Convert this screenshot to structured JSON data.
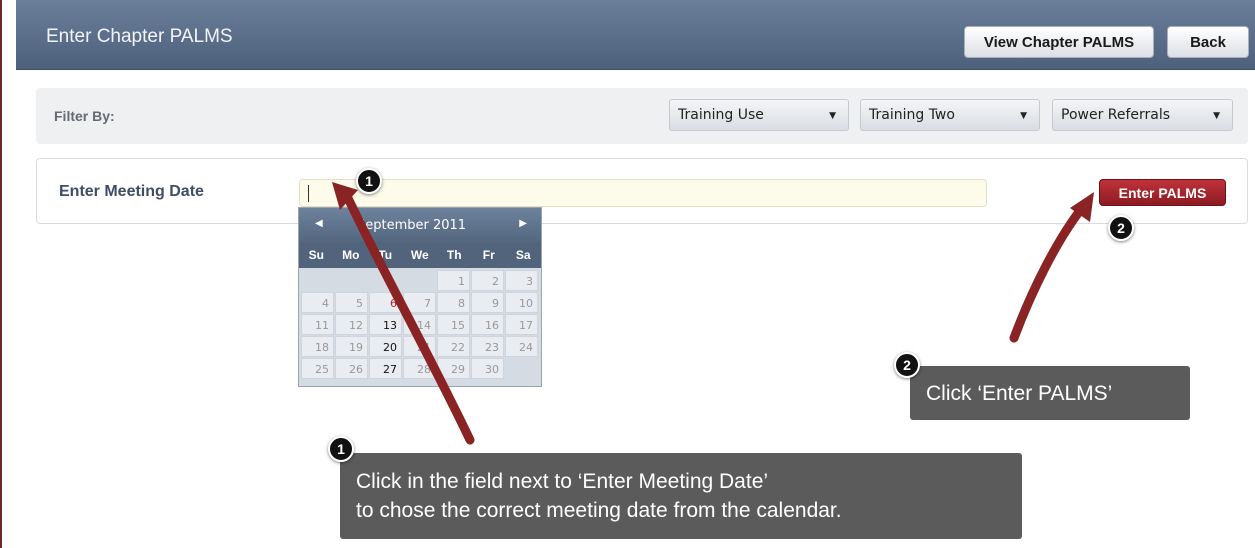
{
  "header": {
    "title": "Enter Chapter PALMS",
    "view_button": "View Chapter PALMS",
    "back_button": "Back"
  },
  "filter": {
    "label": "Filter By:",
    "selects": [
      "Training Use",
      "Training Two",
      "Power Referrals"
    ]
  },
  "meeting": {
    "label": "Enter Meeting Date",
    "date_value": "",
    "enter_button": "Enter PALMS"
  },
  "calendar": {
    "month": "September 2011",
    "weekdays": [
      "Su",
      "Mo",
      "Tu",
      "We",
      "Th",
      "Fr",
      "Sa"
    ],
    "weeks": [
      [
        "",
        "",
        "",
        "",
        "1",
        "2",
        "3"
      ],
      [
        "4",
        "5",
        "6",
        "7",
        "8",
        "9",
        "10"
      ],
      [
        "11",
        "12",
        "13",
        "14",
        "15",
        "16",
        "17"
      ],
      [
        "18",
        "19",
        "20",
        "21",
        "22",
        "23",
        "24"
      ],
      [
        "25",
        "26",
        "27",
        "28",
        "29",
        "30",
        ""
      ]
    ],
    "today": "6",
    "selectable": [
      "13",
      "20",
      "27"
    ]
  },
  "callouts": {
    "one": {
      "badge": "1",
      "line1": "Click in the field next to ‘Enter Meeting Date’",
      "line2": "to chose the correct meeting date from the calendar."
    },
    "two": {
      "badge": "2",
      "text": "Click ‘Enter PALMS’"
    }
  },
  "colors": {
    "header": "#5a6e89",
    "enter_button": "#a5252d",
    "arrow": "#8a2424",
    "callout": "#5b5b5b",
    "today": "#c0262c"
  }
}
